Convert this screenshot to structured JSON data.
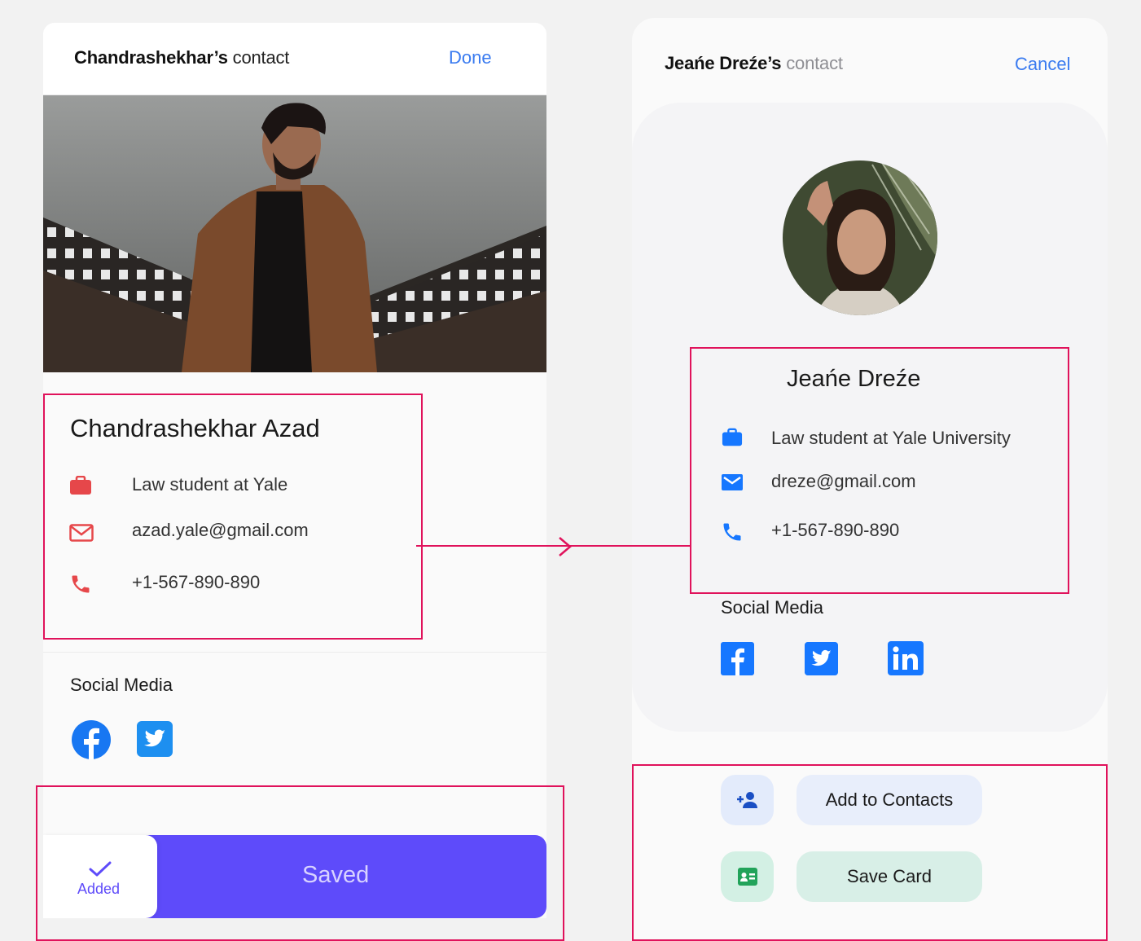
{
  "left": {
    "header": {
      "name": "Chandrashekhar’s",
      "suffix": " contact",
      "action": "Done"
    },
    "name": "Chandrashekhar Azad",
    "job": "Law student at Yale",
    "email": "azad.yale@gmail.com",
    "phone": "+1-567-890-890",
    "social_label": "Social Media",
    "saved_label": "Saved",
    "added_label": "Added",
    "accent": "#e6474a"
  },
  "right": {
    "header": {
      "name": "Jeańe Dreźe’s",
      "suffix": " contact",
      "action": "Cancel"
    },
    "name": "Jeańe Dreźe",
    "job": "Law student at Yale University",
    "email": "dreze@gmail.com",
    "phone": "+1-567-890-890",
    "social_label": "Social Media",
    "add_contacts_label": "Add to Contacts",
    "save_card_label": "Save Card",
    "accent": "#1677ff"
  },
  "colors": {
    "primary_purple": "#5e4bfa",
    "link_blue": "#3a7bf0",
    "annotation": "#e0125b",
    "facebook": "#1877f2"
  }
}
